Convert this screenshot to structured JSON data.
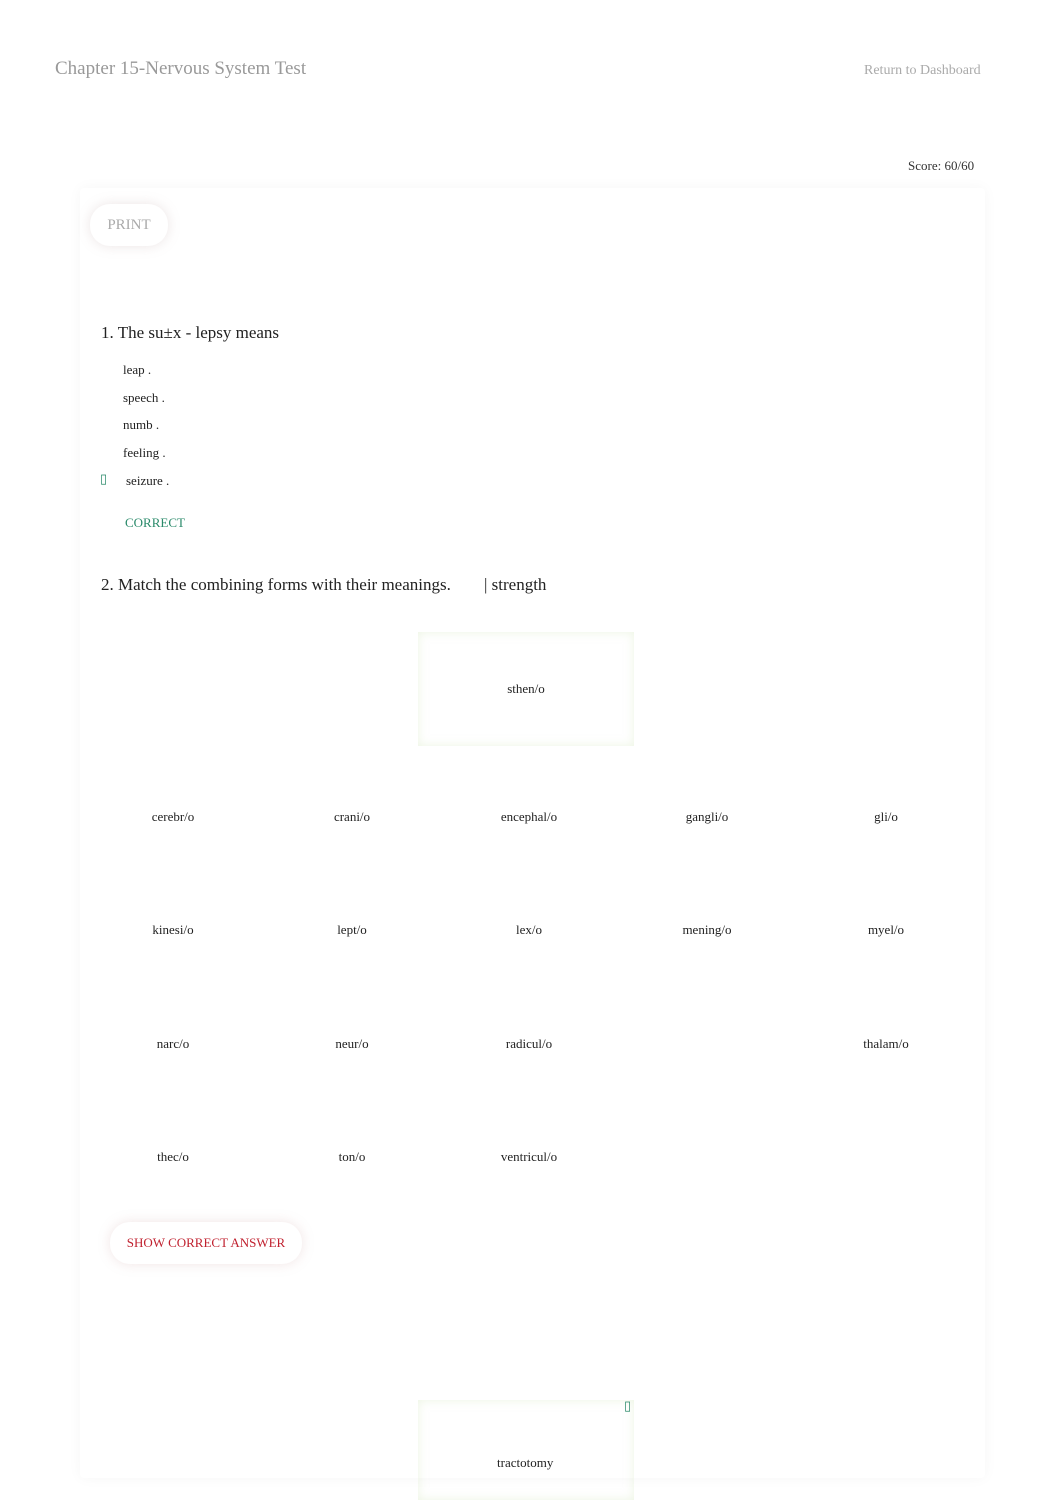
{
  "header": {
    "title": "Chapter 15-Nervous System Test",
    "return_link": "Return to Dashboard",
    "score": "Score: 60/60"
  },
  "toolbar": {
    "print_label": "PRINT"
  },
  "q1": {
    "text": "1. The su±x -    lepsy  means",
    "options": [
      "leap .",
      "speech  .",
      "numb .",
      "feeling .",
      "seizure ."
    ],
    "selected_icon": "check-icon",
    "selected_glyph": "▯",
    "result": "CORRECT",
    "result_color": "#2a8a6a"
  },
  "q2": {
    "text": "2. Match the combining forms with their meanings.",
    "meaning": "| strength",
    "target": "sthen/o",
    "items": [
      "cerebr/o",
      "crani/o",
      "encephal/o",
      "gangli/o",
      "gli/o",
      "kinesi/o",
      "lept/o",
      "lex/o",
      "mening/o",
      "myel/o",
      "narc/o",
      "neur/o",
      "radicul/o",
      "",
      "thalam/o",
      "thec/o",
      "ton/o",
      "ventricul/o"
    ],
    "show_answer": "SHOW CORRECT ANSWER"
  },
  "q3": {
    "target": "tractotomy",
    "icon_glyph": "▯"
  }
}
